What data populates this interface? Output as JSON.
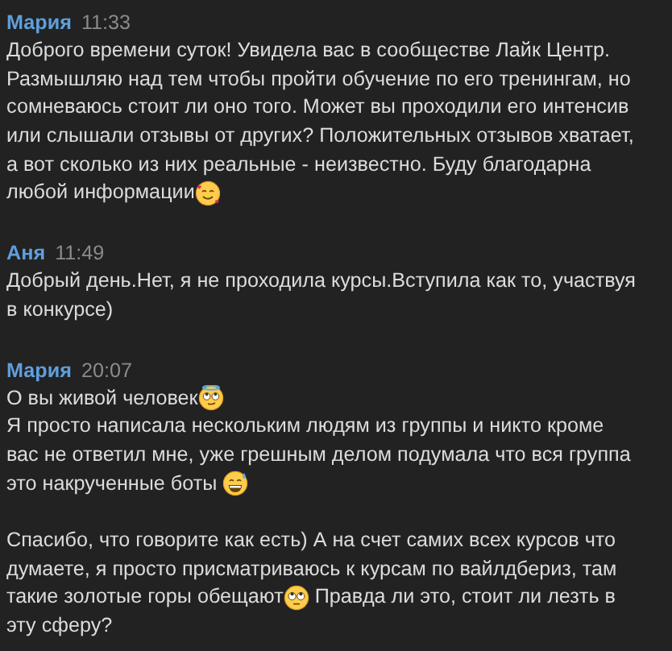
{
  "messages": [
    {
      "author": "Мария",
      "time": "11:33",
      "paragraphs": [
        [
          [
            {
              "kind": "text",
              "text": "Доброго времени суток! Увидела вас в сообществе Лайк Центр."
            }
          ],
          [
            {
              "kind": "text",
              "text": "Размышляю над тем чтобы пройти обучение по его тренингам, но"
            }
          ],
          [
            {
              "kind": "text",
              "text": "сомневаюсь стоит ли оно того. Может вы проходили его интенсив"
            }
          ],
          [
            {
              "kind": "text",
              "text": "или слышали отзывы от других? Положительных отзывов хватает,"
            }
          ],
          [
            {
              "kind": "text",
              "text": "а вот сколько из них реальные - неизвестно. Буду благодарна"
            }
          ],
          [
            {
              "kind": "text",
              "text": "любой информации"
            },
            {
              "kind": "hearts-emoji"
            }
          ]
        ]
      ]
    },
    {
      "author": "Аня",
      "time": "11:49",
      "paragraphs": [
        [
          [
            {
              "kind": "text",
              "text": "Добрый день.Нет, я не проходила курсы.Вступила как то, участвуя"
            }
          ],
          [
            {
              "kind": "text",
              "text": "в конкурсе)"
            }
          ]
        ]
      ]
    },
    {
      "author": "Мария",
      "time": "20:07",
      "paragraphs": [
        [
          [
            {
              "kind": "text",
              "text": "О вы живой человек"
            },
            {
              "kind": "halo-emoji"
            }
          ],
          [
            {
              "kind": "text",
              "text": "Я просто написала нескольким людям из группы и никто кроме"
            }
          ],
          [
            {
              "kind": "text",
              "text": "вас не ответил мне, уже грешным делом подумала что вся группа"
            }
          ],
          [
            {
              "kind": "text",
              "text": "это накрученные боты "
            },
            {
              "kind": "sweat-emoji"
            }
          ]
        ],
        [
          [
            {
              "kind": "text",
              "text": "Спасибо, что говорите как есть) А на счет самих всех курсов что"
            }
          ],
          [
            {
              "kind": "text",
              "text": "думаете, я просто присматриваюсь к курсам по вайлдбериз, там"
            }
          ],
          [
            {
              "kind": "text",
              "text": "такие золотые горы обещают"
            },
            {
              "kind": "eyeroll-emoji"
            },
            {
              "kind": "text",
              "text": " Правда ли это, стоит ли лезть в"
            }
          ],
          [
            {
              "kind": "text",
              "text": "эту сферу?"
            }
          ]
        ]
      ]
    }
  ]
}
